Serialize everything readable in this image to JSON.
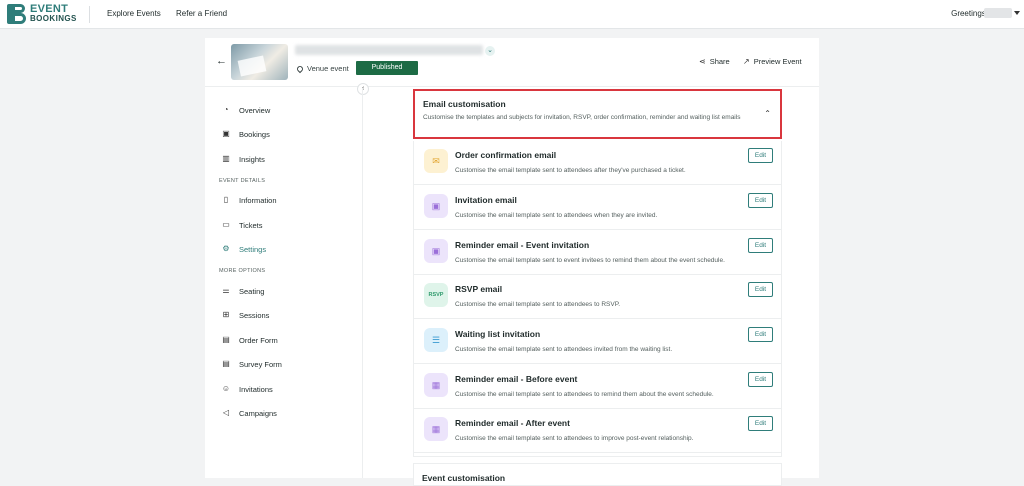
{
  "topbar": {
    "logo_line1": "EVENT",
    "logo_line2": "BOOKINGS",
    "nav": [
      "Explore Events",
      "Refer a Friend"
    ],
    "greeting": "Greetings!"
  },
  "event": {
    "venue_type": "Venue event",
    "status": "Published",
    "share_label": "Share",
    "preview_label": "Preview Event"
  },
  "sidebar": {
    "items_top": [
      {
        "label": "Overview",
        "icon": "gauge-icon"
      },
      {
        "label": "Bookings",
        "icon": "calendar-icon"
      },
      {
        "label": "Insights",
        "icon": "bar-chart-icon"
      }
    ],
    "section1": "EVENT DETAILS",
    "items_details": [
      {
        "label": "Information",
        "icon": "document-icon"
      },
      {
        "label": "Tickets",
        "icon": "ticket-icon"
      },
      {
        "label": "Settings",
        "icon": "gear-icon",
        "active": true
      }
    ],
    "section2": "MORE OPTIONS",
    "items_more": [
      {
        "label": "Seating",
        "icon": "sliders-icon"
      },
      {
        "label": "Sessions",
        "icon": "grid-icon"
      },
      {
        "label": "Order Form",
        "icon": "form-icon"
      },
      {
        "label": "Survey Form",
        "icon": "survey-icon"
      },
      {
        "label": "Invitations",
        "icon": "user-icon"
      },
      {
        "label": "Campaigns",
        "icon": "megaphone-icon"
      }
    ]
  },
  "email_section": {
    "title": "Email customisation",
    "description": "Customise the templates and subjects for invitation, RSVP, order confirmation, reminder and waiting list emails"
  },
  "emails": [
    {
      "title": "Order confirmation email",
      "desc": "Customise the email template sent to attendees after they've purchased a ticket.",
      "icon": "envelope-icon",
      "tile": "yellow",
      "glyph": "✉",
      "edit": "Edit"
    },
    {
      "title": "Invitation email",
      "desc": "Customise the email template sent to attendees when they are invited.",
      "icon": "clipboard-check-icon",
      "tile": "purple",
      "glyph": "▣",
      "edit": "Edit"
    },
    {
      "title": "Reminder email - Event invitation",
      "desc": "Customise the email template sent to event invitees to remind them about the event schedule.",
      "icon": "clipboard-check-icon",
      "tile": "purple",
      "glyph": "▣",
      "edit": "Edit"
    },
    {
      "title": "RSVP email",
      "desc": "Customise the email template sent to attendees to RSVP.",
      "icon": "rsvp-icon",
      "tile": "green",
      "glyph": "RSVP",
      "edit": "Edit"
    },
    {
      "title": "Waiting list invitation",
      "desc": "Customise the email template sent to attendees invited from the waiting list.",
      "icon": "list-icon",
      "tile": "blue",
      "glyph": "☰",
      "edit": "Edit"
    },
    {
      "title": "Reminder email - Before event",
      "desc": "Customise the email template sent to attendees to remind them about the event schedule.",
      "icon": "calendar-icon",
      "tile": "purple",
      "glyph": "▦",
      "edit": "Edit"
    },
    {
      "title": "Reminder email - After event",
      "desc": "Customise the email template sent to attendees to improve post-event relationship.",
      "icon": "calendar-icon",
      "tile": "purple",
      "glyph": "▦",
      "edit": "Edit"
    }
  ],
  "next_section": {
    "title": "Event customisation"
  }
}
